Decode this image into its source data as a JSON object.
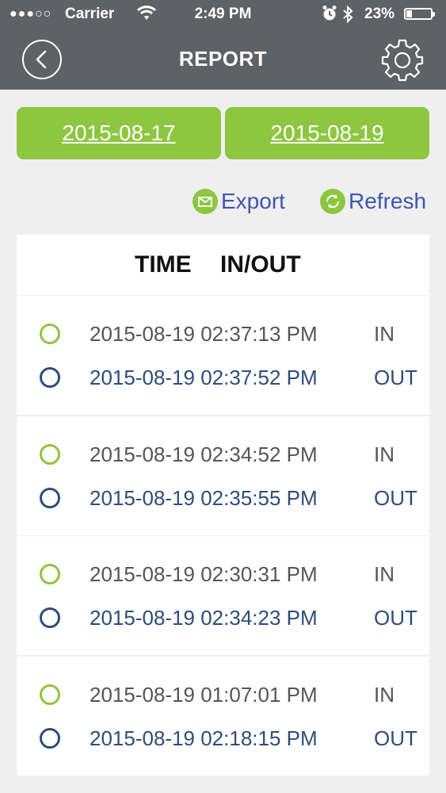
{
  "status_bar": {
    "signal": "●●●○○",
    "carrier": "Carrier",
    "time": "2:49 PM",
    "battery_percent": "23%",
    "battery_level": 0.23,
    "icons": [
      "wifi-icon",
      "alarm-icon",
      "bluetooth-icon",
      "battery-icon"
    ]
  },
  "nav": {
    "title": "REPORT",
    "back_icon": "chevron-left-icon",
    "settings_icon": "gear-icon"
  },
  "date_range": {
    "start": "2015-08-17",
    "end": "2015-08-19"
  },
  "actions": {
    "export": "Export",
    "refresh": "Refresh"
  },
  "table": {
    "headers": [
      "TIME",
      "IN/OUT"
    ],
    "records": [
      {
        "in_time": "2015-08-19 02:37:13 PM",
        "in_label": "IN",
        "out_time": "2015-08-19 02:37:52 PM",
        "out_label": "OUT"
      },
      {
        "in_time": "2015-08-19 02:34:52 PM",
        "in_label": "IN",
        "out_time": "2015-08-19 02:35:55 PM",
        "out_label": "OUT"
      },
      {
        "in_time": "2015-08-19 02:30:31 PM",
        "in_label": "IN",
        "out_time": "2015-08-19 02:34:23 PM",
        "out_label": "OUT"
      },
      {
        "in_time": "2015-08-19 01:07:01 PM",
        "in_label": "IN",
        "out_time": "2015-08-19 02:18:15 PM",
        "out_label": "OUT"
      }
    ]
  },
  "colors": {
    "accent_green": "#8dc63f",
    "nav_gray": "#5f6166",
    "link_blue": "#3f56b0",
    "out_blue": "#2e4d7b"
  }
}
